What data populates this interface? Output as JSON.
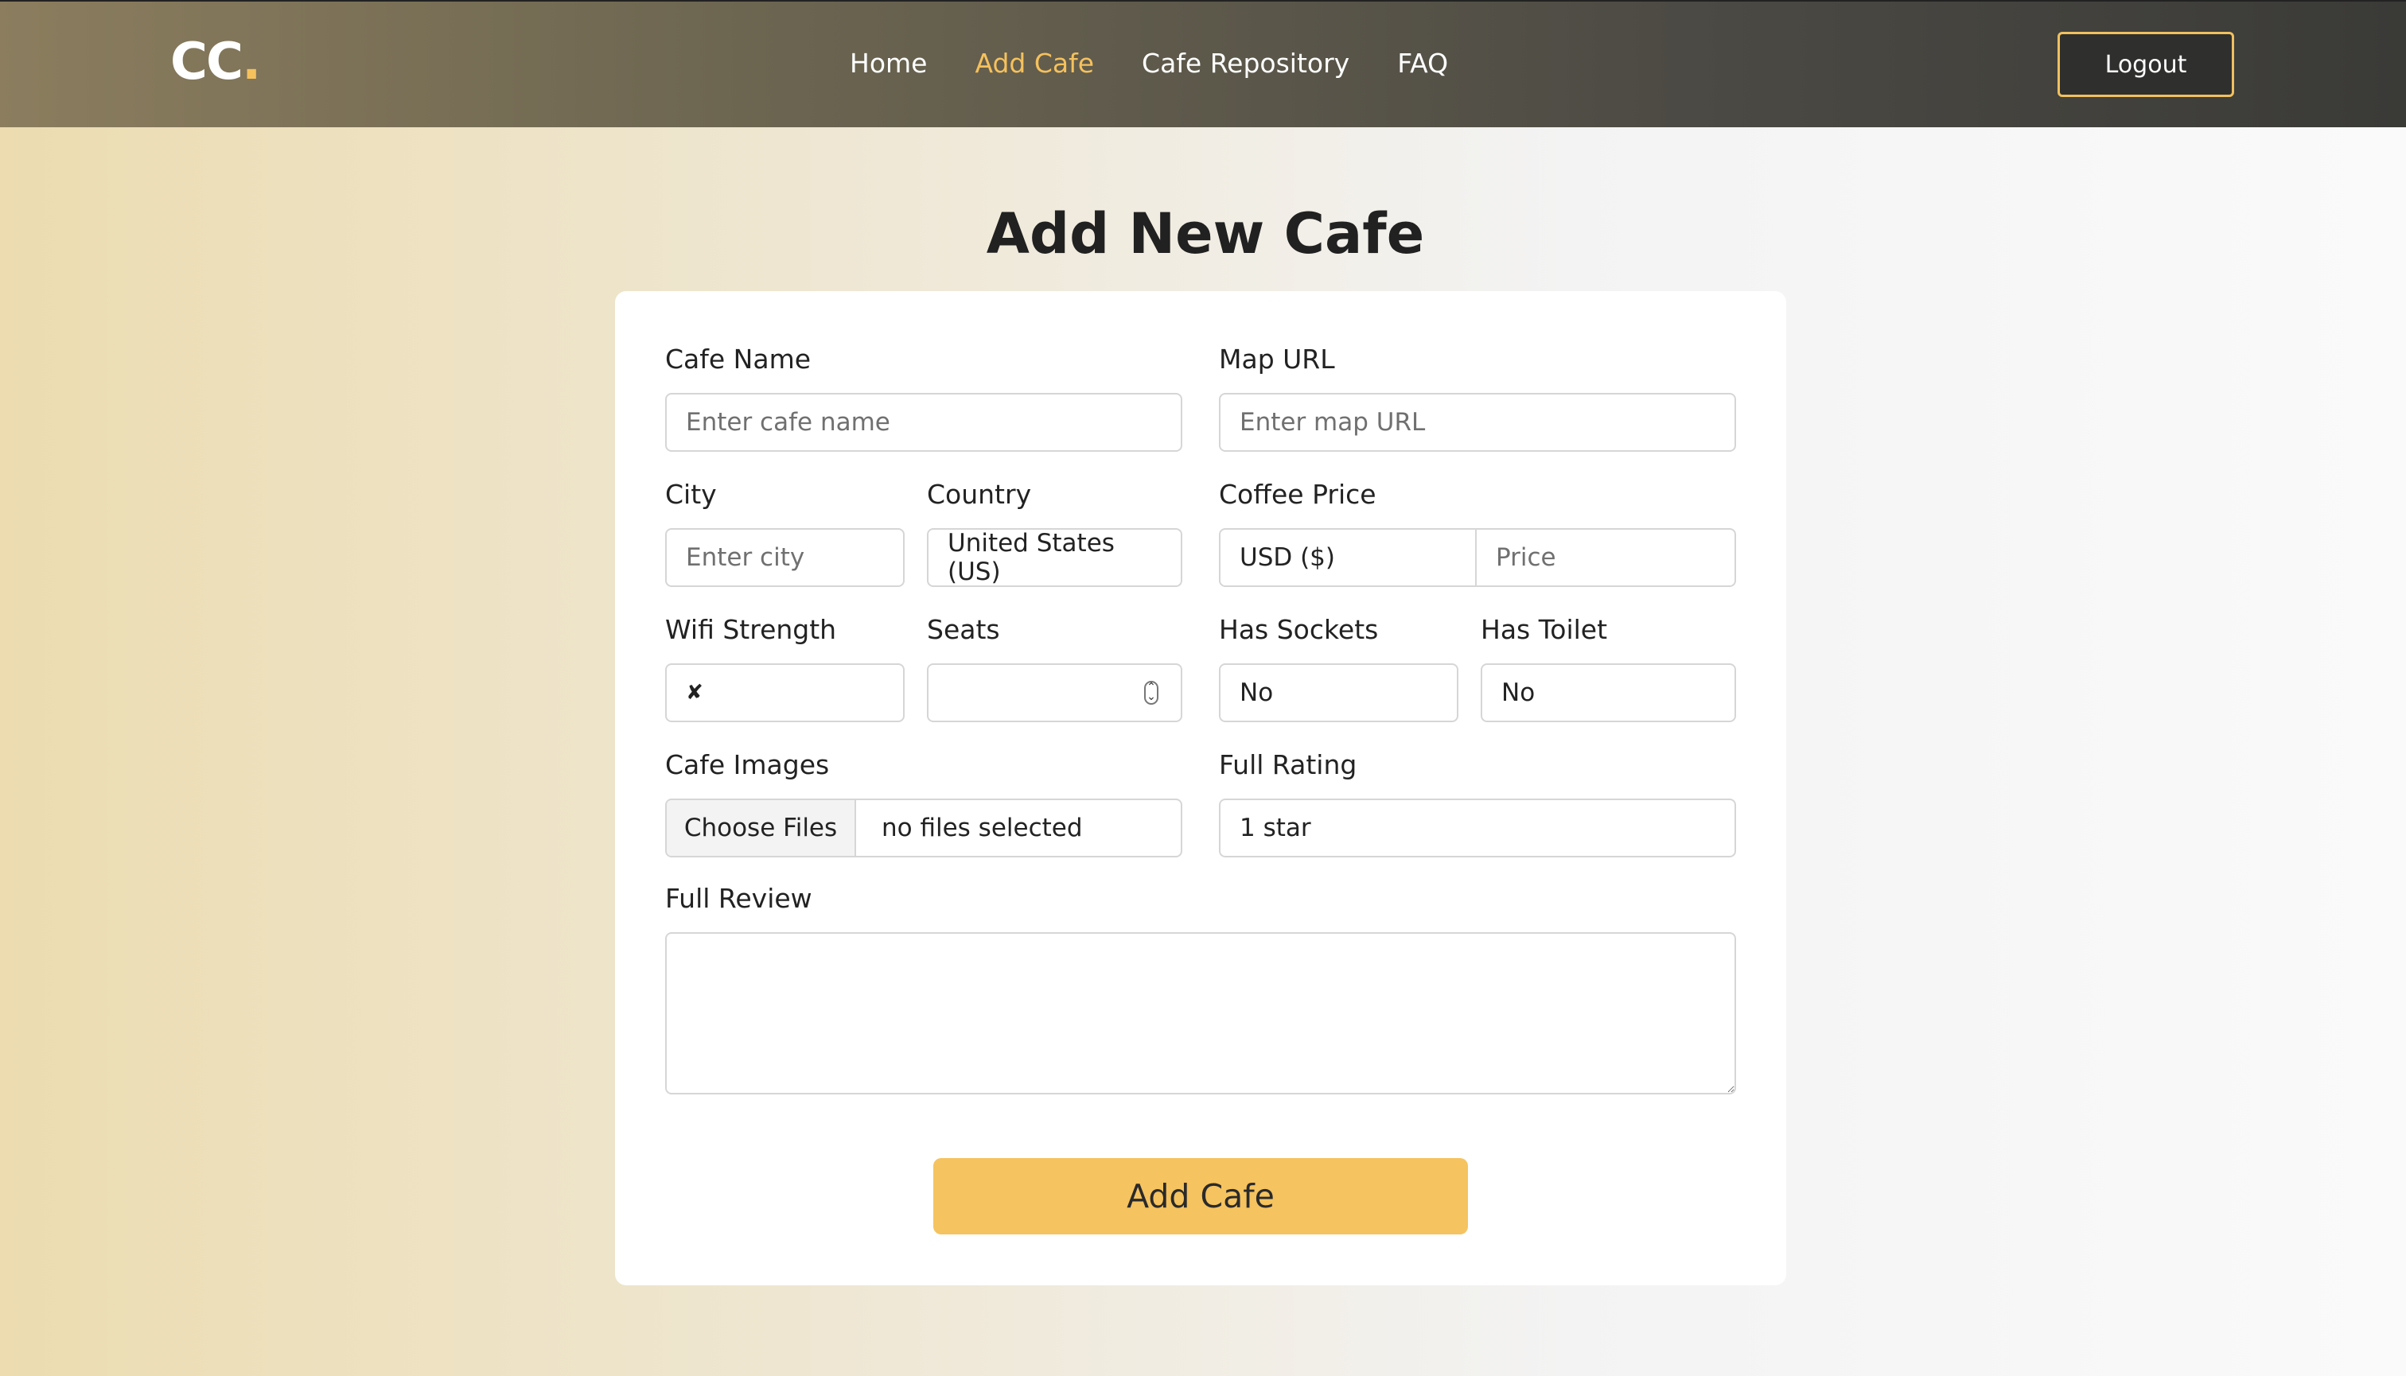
{
  "nav": {
    "logo_text": "CC",
    "logo_dot": ".",
    "links": [
      "Home",
      "Add Cafe",
      "Cafe Repository",
      "FAQ"
    ],
    "active_link": "Add Cafe",
    "logout_label": "Logout"
  },
  "page": {
    "title": "Add New Cafe"
  },
  "form": {
    "cafe_name": {
      "label": "Cafe Name",
      "placeholder": "Enter cafe name",
      "value": ""
    },
    "map_url": {
      "label": "Map URL",
      "placeholder": "Enter map URL",
      "value": ""
    },
    "city": {
      "label": "City",
      "placeholder": "Enter city",
      "value": ""
    },
    "country": {
      "label": "Country",
      "value": "United States (US)"
    },
    "coffee_price": {
      "label": "Coffee Price",
      "currency": "USD ($)",
      "placeholder": "Price",
      "value": ""
    },
    "wifi_strength": {
      "label": "Wifi Strength",
      "value": "✘"
    },
    "seats": {
      "label": "Seats",
      "value": ""
    },
    "has_sockets": {
      "label": "Has Sockets",
      "value": "No"
    },
    "has_toilet": {
      "label": "Has Toilet",
      "value": "No"
    },
    "cafe_images": {
      "label": "Cafe Images",
      "button_label": "Choose Files",
      "status": "no files selected"
    },
    "full_rating": {
      "label": "Full Rating",
      "value": "1 star"
    },
    "full_review": {
      "label": "Full Review",
      "value": ""
    },
    "submit_label": "Add Cafe"
  },
  "colors": {
    "accent": "#f5c15d",
    "submit_bg": "#f5c35f",
    "nav_dark": "#3a3a37"
  }
}
